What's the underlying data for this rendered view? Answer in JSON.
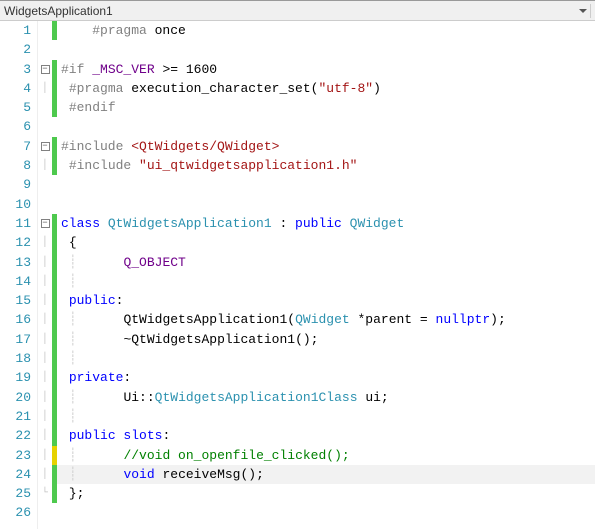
{
  "tab": {
    "title": "WidgetsApplication1"
  },
  "line_count": 26,
  "fold": {
    "3": "minus",
    "4": "bar",
    "7": "minus",
    "8": "bar",
    "11": "minus",
    "12": "bar",
    "13": "bar",
    "14": "bar",
    "15": "bar",
    "16": "bar",
    "17": "bar",
    "18": "bar",
    "19": "bar",
    "20": "bar",
    "21": "bar",
    "22": "bar",
    "23": "bar",
    "24": "bar",
    "25": "end"
  },
  "changes": {
    "1": "g",
    "3": "g",
    "4": "g",
    "5": "g",
    "7": "g",
    "8": "g",
    "11": "g",
    "12": "g",
    "13": "g",
    "14": "g",
    "15": "g",
    "16": "g",
    "17": "g",
    "18": "g",
    "19": "g",
    "20": "g",
    "21": "g",
    "22": "g",
    "23": "y",
    "24": "g",
    "25": "g"
  },
  "current_line": 24,
  "code": {
    "l1": {
      "t1": "#pragma",
      "t2": " once"
    },
    "l3": {
      "t1": "#if ",
      "t2": "_MSC_VER",
      "t3": " >= 1600"
    },
    "l4": {
      "t1": "#pragma",
      "t2": " execution_character_set(",
      "t3": "\"utf-8\"",
      "t4": ")"
    },
    "l5": {
      "t1": "#endif"
    },
    "l7": {
      "t1": "#include ",
      "t2": "<QtWidgets/QWidget>"
    },
    "l8": {
      "t1": "#include ",
      "t2": "\"ui_qtwidgetsapplication1.h\""
    },
    "l11": {
      "t1": "class ",
      "t2": "QtWidgetsApplication1",
      "t3": " : ",
      "t4": "public ",
      "t5": "QWidget"
    },
    "l12": {
      "t1": "{"
    },
    "l13": {
      "t1": "Q_OBJECT"
    },
    "l15": {
      "t1": "public",
      "t2": ":"
    },
    "l16": {
      "t1": "QtWidgetsApplication1(",
      "t2": "QWidget",
      "t3": " *parent = ",
      "t4": "nullptr",
      "t5": ");"
    },
    "l17": {
      "t1": "~QtWidgetsApplication1();"
    },
    "l19": {
      "t1": "private",
      "t2": ":"
    },
    "l20": {
      "t1": "Ui::",
      "t2": "QtWidgetsApplication1Class",
      "t3": " ui;"
    },
    "l22": {
      "t1": "public ",
      "t2": "slots",
      "t3": ":"
    },
    "l23": {
      "t1": "//void on_openfile_clicked();"
    },
    "l24": {
      "t1": "void",
      "t2": " receiveMsg();"
    },
    "l25": {
      "t1": "};"
    }
  }
}
